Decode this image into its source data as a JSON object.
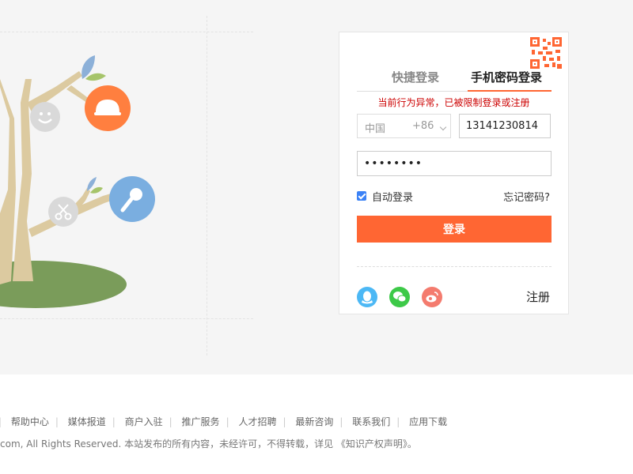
{
  "login": {
    "tabs": [
      "快捷登录",
      "手机密码登录"
    ],
    "active_tab": "手机密码登录",
    "error_message": "当前行为异常，已被限制登录或注册",
    "country_name": "中国",
    "country_code": "+86",
    "phone_value": "13141230814",
    "password_masked": "••••••••",
    "auto_login_label": "自动登录",
    "auto_login_checked": true,
    "forgot_label": "忘记密码?",
    "login_button": "登录",
    "register_label": "注册",
    "social_icons": [
      "qq-icon",
      "wechat-icon",
      "weibo-icon"
    ]
  },
  "footer": {
    "links": [
      "帮助中心",
      "媒体报道",
      "商户入驻",
      "推广服务",
      "人才招聘",
      "最新咨询",
      "联系我们",
      "应用下载"
    ],
    "copyright": "com, All Rights Reserved.   本站发布的所有内容，未经许可，不得转载，详见 《知识产权声明》。"
  },
  "colors": {
    "accent": "#ff6633",
    "error": "#cc0000",
    "checkbox": "#3b82f6",
    "qq": "#4cb8f5",
    "wechat": "#3dc948",
    "weibo": "#f47b6e"
  }
}
